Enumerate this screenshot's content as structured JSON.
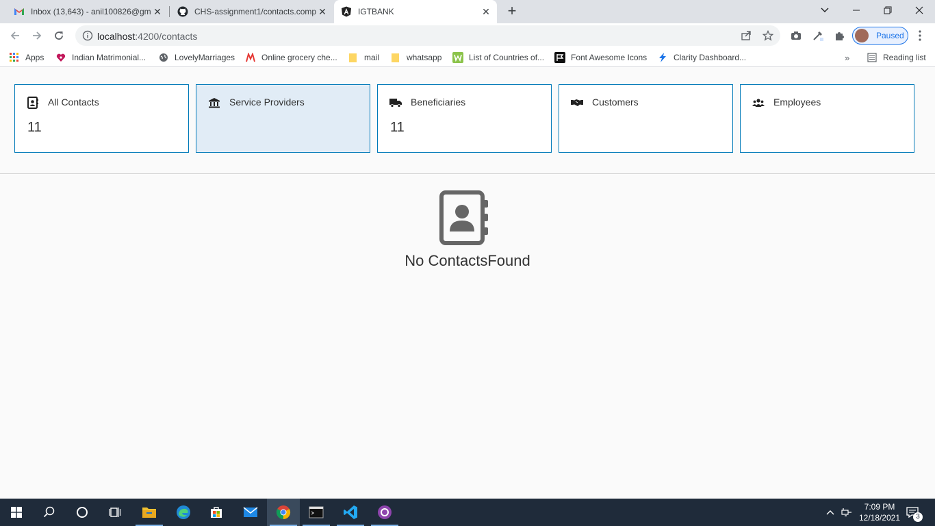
{
  "browser": {
    "tabs": [
      {
        "title": "Inbox (13,643) - anil100826@gm",
        "icon": "gmail-icon"
      },
      {
        "title": "CHS-assignment1/contacts.comp",
        "icon": "github-icon"
      },
      {
        "title": "IGTBANK",
        "icon": "angular-icon",
        "active": true
      }
    ],
    "url_host": "localhost",
    "url_path": ":4200/contacts",
    "profile_label": "Paused",
    "bookmarks": [
      {
        "label": "Apps",
        "icon": "apps-grid-icon"
      },
      {
        "label": "Indian Matrimonial...",
        "icon": "heart-icon"
      },
      {
        "label": "LovelyMarriages",
        "icon": "globe-icon"
      },
      {
        "label": "Online grocery che...",
        "icon": "grocery-icon"
      },
      {
        "label": "mail",
        "icon": "folder-icon"
      },
      {
        "label": "whatsapp",
        "icon": "folder-icon"
      },
      {
        "label": "List of Countries of...",
        "icon": "w-icon"
      },
      {
        "label": "Font Awesome Icons",
        "icon": "flag-icon"
      },
      {
        "label": "Clarity Dashboard...",
        "icon": "bolt-icon"
      }
    ],
    "reading_list": "Reading list"
  },
  "cards": [
    {
      "title": "All Contacts",
      "count": "11",
      "icon": "address-book-icon"
    },
    {
      "title": "Service Providers",
      "count": "",
      "icon": "bank-icon",
      "selected": true
    },
    {
      "title": "Beneficiaries",
      "count": "11",
      "icon": "truck-icon"
    },
    {
      "title": "Customers",
      "count": "",
      "icon": "handshake-icon"
    },
    {
      "title": "Employees",
      "count": "",
      "icon": "users-icon"
    }
  ],
  "empty_state": {
    "message": "No ContactsFound",
    "icon": "address-book-icon"
  },
  "taskbar": {
    "time": "7:09 PM",
    "date": "12/18/2021",
    "notification_count": "3"
  },
  "colors": {
    "accent": "#0079b8",
    "selected_card": "#e1ecf6",
    "taskbar": "#1f2b3a"
  }
}
